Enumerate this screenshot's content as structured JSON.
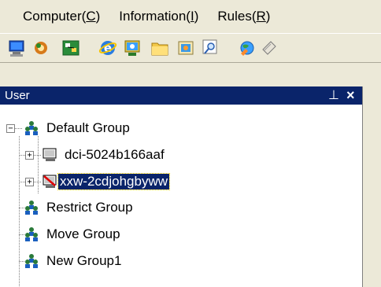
{
  "menu": [
    {
      "label": "Computer(",
      "accel": "C",
      "tail": ")"
    },
    {
      "label": "Information(",
      "accel": "I",
      "tail": ")"
    },
    {
      "label": "Rules(",
      "accel": "R",
      "tail": ")"
    }
  ],
  "toolbar": {
    "icons": [
      "computer-icon",
      "settings-icon",
      "network-icon",
      "browser-icon",
      "monitor-icon",
      "folder-icon",
      "message-icon",
      "search-icon",
      "globe-icon",
      "document-icon"
    ]
  },
  "panel": {
    "title": "User",
    "pin_glyph": "⊥",
    "close_glyph": "×"
  },
  "tree": {
    "root": {
      "label": "Default Group",
      "expander": "−"
    },
    "computers": [
      {
        "label": "dci-5024b166aaf",
        "expander": "+",
        "status": "normal"
      },
      {
        "label": "xxw-2cdjohgbyww",
        "expander": "+",
        "status": "blocked",
        "selected": true
      }
    ],
    "groups": [
      {
        "label": "Restrict Group"
      },
      {
        "label": "Move Group"
      },
      {
        "label": "New Group1"
      }
    ]
  },
  "colors": {
    "header_bg": "#0a246a",
    "selection_bg": "#0a246a",
    "chrome_bg": "#ece9d8"
  }
}
